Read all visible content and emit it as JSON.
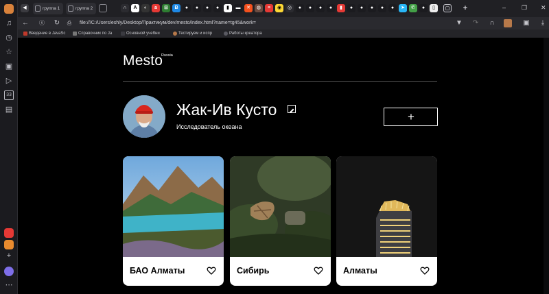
{
  "browser": {
    "tabs": [
      {
        "label": "группа 1"
      },
      {
        "label": "группа 2"
      }
    ],
    "url": "file:///C:/Users/eshly/Desktop/Практикум/dev/mesto/index.html?name=tg45&work=",
    "bookmarks": [
      {
        "label": "Введение в JavaSc",
        "color": "#c0392b"
      },
      {
        "label": "Справочник по Ja",
        "color": "#777777"
      },
      {
        "label": "Основной учебни",
        "color": "#3a3a40"
      },
      {
        "label": "Тестируем и испр",
        "color": "#b7794a"
      },
      {
        "label": "Работы креатора",
        "color": "#5a5a62"
      }
    ],
    "window_controls": [
      "–",
      "❐",
      "✕"
    ]
  },
  "site": {
    "logo": "Mesto",
    "logo_sup": "Russia"
  },
  "profile": {
    "name": "Жак-Ив Кусто",
    "job": "Исследователь океана",
    "add_symbol": "+"
  },
  "cards": [
    {
      "title": "БАО Алматы",
      "liked": false
    },
    {
      "title": "Сибирь",
      "liked": false
    },
    {
      "title": "Алматы",
      "liked": false
    }
  ],
  "icons": [
    "edit-icon",
    "add-icon",
    "heart-icon",
    "back-icon",
    "forward-icon",
    "reload-icon",
    "bookmark-icon",
    "download-icon"
  ]
}
